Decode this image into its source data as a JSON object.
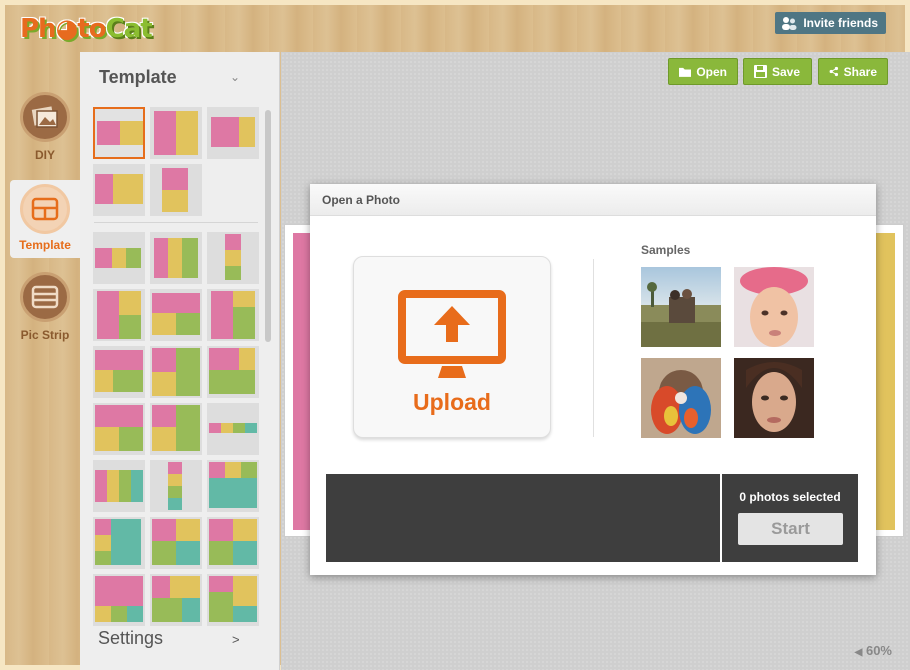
{
  "app": {
    "logo_text_1": "Ph",
    "logo_text_2": "to",
    "logo_text_3": "Cat",
    "invite_label": "Invite friends"
  },
  "rail": {
    "items": [
      {
        "label": "DIY",
        "icon": "photos-icon"
      },
      {
        "label": "Template",
        "icon": "template-layout-icon"
      },
      {
        "label": "Pic Strip",
        "icon": "pic-strip-icon"
      }
    ]
  },
  "panel": {
    "title": "Template",
    "settings_label": "Settings",
    "settings_chevron": ">"
  },
  "toolbar": {
    "open_label": "Open",
    "save_label": "Save",
    "share_label": "Share"
  },
  "modal": {
    "title": "Open a Photo",
    "upload_label": "Upload",
    "samples_label": "Samples",
    "photos_selected": "0 photos selected",
    "start_label": "Start"
  },
  "zoom": {
    "value": "60%"
  },
  "colors": {
    "accent_orange": "#e86c1b",
    "button_green": "#8ab83b",
    "invite_blue": "#4f7684",
    "template_pink": "#de78a4",
    "template_yellow": "#e1c35d",
    "template_green": "#98bb58",
    "template_teal": "#62b9a6"
  }
}
